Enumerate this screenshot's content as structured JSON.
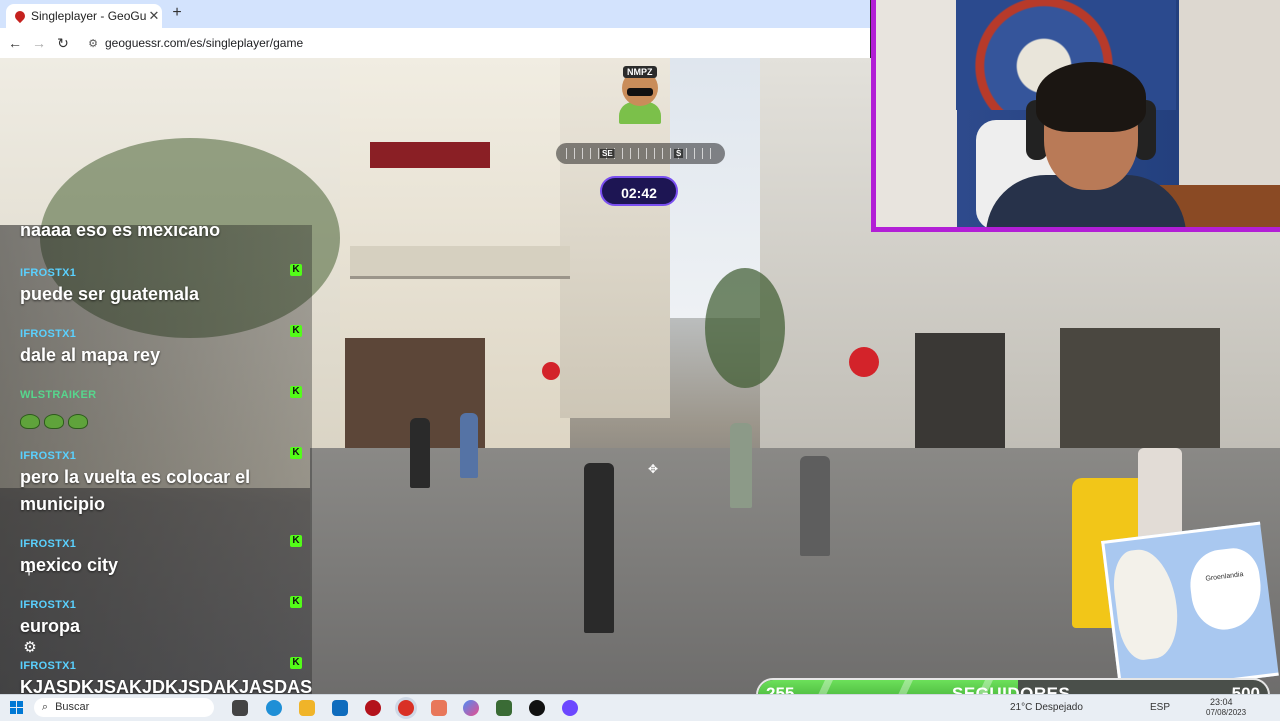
{
  "browser": {
    "tab_title": "Singleplayer - GeoGuessr",
    "tab_close": "✕",
    "new_tab": "+",
    "back": "←",
    "forward": "→",
    "reload": "↻",
    "url": "geoguessr.com/es/singleplayer/game"
  },
  "game": {
    "mode_badge": "NMPZ",
    "timer": "02:42",
    "compass_left": "SE",
    "compass_right": "S"
  },
  "chat": {
    "messages": [
      {
        "user": "",
        "text": "naaaa eso es mexicano",
        "badge": ""
      },
      {
        "user": "IFROSTX1",
        "text": "puede ser guatemala",
        "badge": "K"
      },
      {
        "user": "IFROSTX1",
        "text": "dale al mapa rey",
        "badge": "K"
      },
      {
        "user": "WLSTRAIKER",
        "text": "",
        "badge": "K"
      },
      {
        "user": "IFROSTX1",
        "text": "pero la vuelta es colocar el",
        "text2": "municipio",
        "badge": "K"
      },
      {
        "user": "IFROSTX1",
        "text": "mexico city",
        "badge": "K"
      },
      {
        "user": "IFROSTX1",
        "text": "europa",
        "badge": "K"
      },
      {
        "user": "IFROSTX1",
        "text": "KJASDKJSAKJDKJSDAKJASDAS",
        "badge": "K"
      }
    ],
    "colors": {
      "ifrostx1": "#5ad1ff",
      "wlstraiker": "#57d68d"
    }
  },
  "minimap": {
    "label": "Groenlandia"
  },
  "followers": {
    "current": "255",
    "label": "SEGUIDORES",
    "goal": "500",
    "progress": 0.51
  },
  "taskbar": {
    "search_placeholder": "Buscar",
    "weather": "21°C  Despejado",
    "lang": "ESP",
    "time": "23:04",
    "date": "07/08/2023"
  }
}
